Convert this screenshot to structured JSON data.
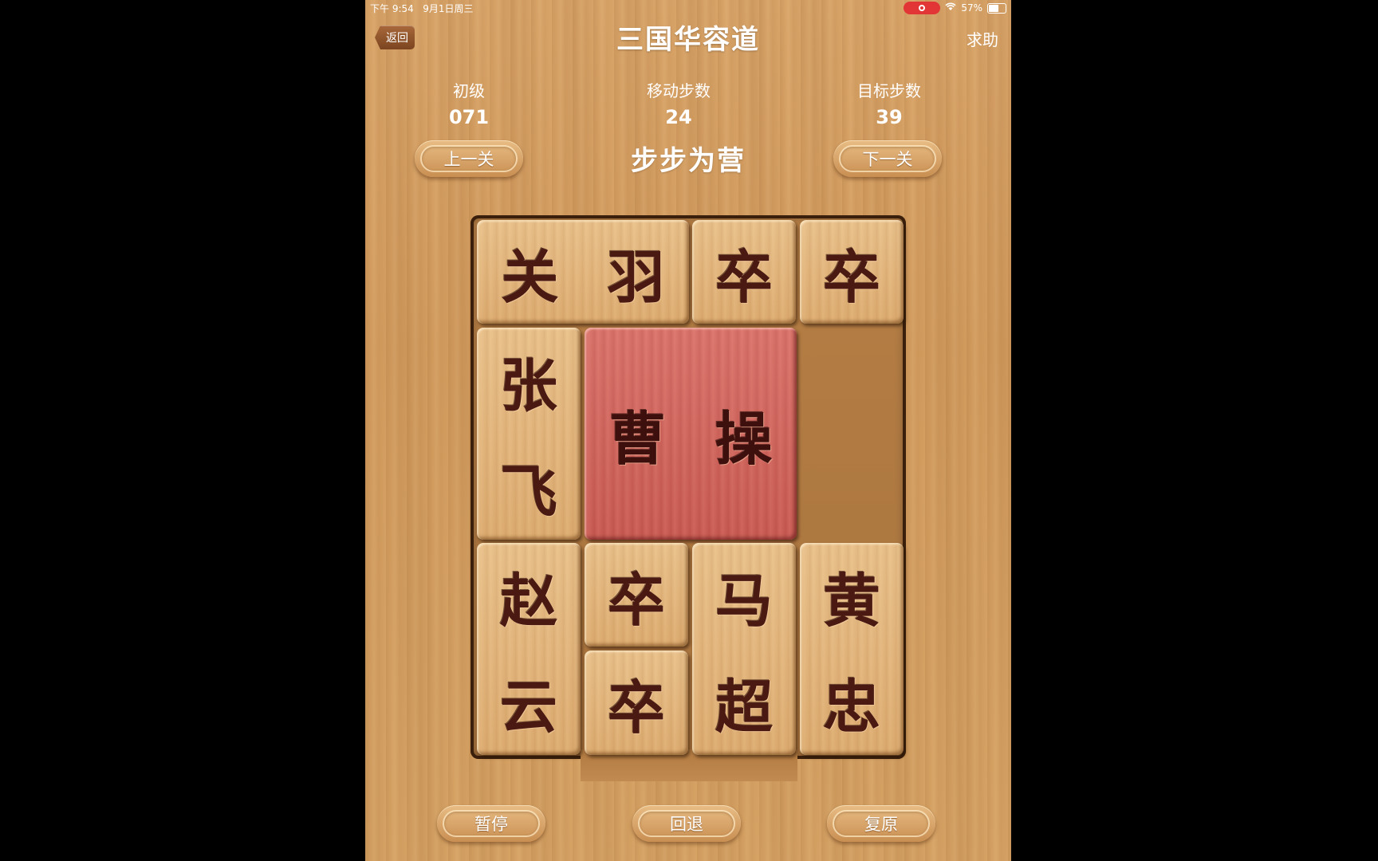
{
  "status_bar": {
    "time": "下午 9:54",
    "date": "9月1日周三",
    "battery": "57%"
  },
  "header": {
    "back_label": "返回",
    "title": "三国华容道",
    "help_label": "求助"
  },
  "stats": [
    {
      "label": "初级",
      "value": "071"
    },
    {
      "label": "移动步数",
      "value": "24"
    },
    {
      "label": "目标步数",
      "value": "39"
    }
  ],
  "nav": {
    "prev_label": "上一关",
    "next_label": "下一关",
    "level_name": "步步为营"
  },
  "pieces": {
    "guanyu": [
      "关",
      "羽"
    ],
    "zu1": "卒",
    "zu2": "卒",
    "zhangfei": [
      "张",
      "飞"
    ],
    "caocao": [
      "曹",
      "操"
    ],
    "zhaoyun": [
      "赵",
      "云"
    ],
    "zu3": "卒",
    "zu4": "卒",
    "machao": [
      "马",
      "超"
    ],
    "huangzhong": [
      "黄",
      "忠"
    ]
  },
  "controls": {
    "pause_label": "暂停",
    "undo_label": "回退",
    "reset_label": "复原"
  },
  "colors": {
    "wood": "#d6a264",
    "caocao_piece": "#c85a52",
    "glyph": "#4a1a12"
  }
}
